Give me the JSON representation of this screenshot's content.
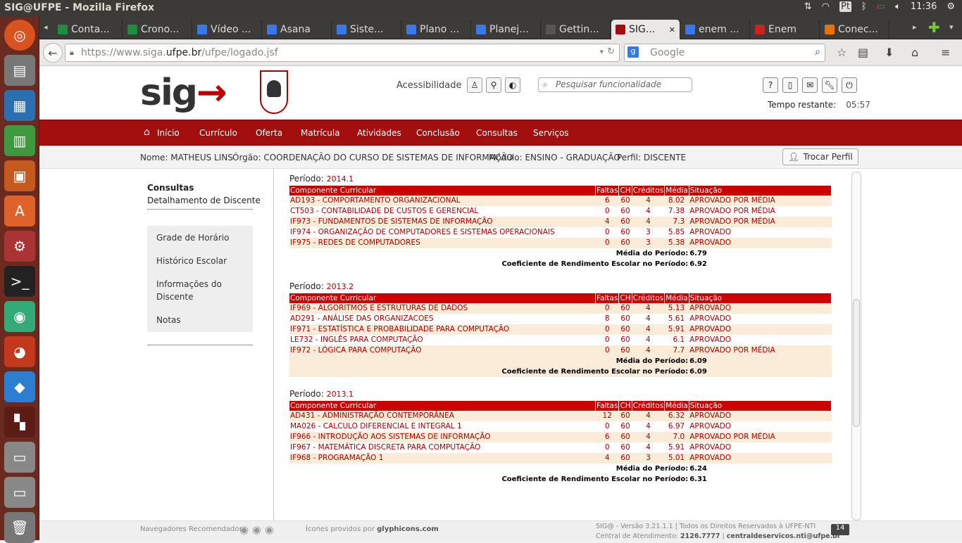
{
  "os": {
    "window_title": "SIG@UFPE - Mozilla Firefox",
    "clock": "11:36"
  },
  "browser": {
    "tabs": [
      {
        "label": "Conta...",
        "color": "#1e8e3e"
      },
      {
        "label": "Crono...",
        "color": "#1e8e3e"
      },
      {
        "label": "Vídeo ...",
        "color": "#3b78e7"
      },
      {
        "label": "Asana",
        "color": "#3b78e7"
      },
      {
        "label": "Siste...",
        "color": "#3b78e7"
      },
      {
        "label": "Plano ...",
        "color": "#3b78e7"
      },
      {
        "label": "Planej...",
        "color": "#3b78e7"
      },
      {
        "label": "Gettin...",
        "color": "#555555"
      },
      {
        "label": "SIG...",
        "color": "#a30e0e"
      },
      {
        "label": "enem ...",
        "color": "#3b78e7"
      },
      {
        "label": "Enem",
        "color": "#cc2222"
      },
      {
        "label": "Conec...",
        "color": "#e8710a"
      }
    ],
    "url_prefix": "https://www.siga.",
    "url_domain": "ufpe.br",
    "url_path": "/ufpe/logado.jsf",
    "search_placeholder": "Google"
  },
  "header": {
    "logo": "sig",
    "accessibility_label": "Acessibilidade",
    "search_placeholder": "Pesquisar funcionalidade",
    "tempo_label": "Tempo restante:",
    "tempo_value": "05:57"
  },
  "menu": [
    "Início",
    "Currículo",
    "Oferta",
    "Matrícula",
    "Atividades",
    "Conclusão",
    "Consultas",
    "Serviços"
  ],
  "user": {
    "nome_label": "Nome:",
    "nome": "MATHEUS LINS",
    "orgao_label": "Órgão:",
    "orgao": "COORDENAÇÃO DO CURSO DE SISTEMAS DE INFORMAÇÃO",
    "modulo_label": "Módulo:",
    "modulo": "ENSINO - GRADUAÇÃO",
    "perfil_label": "Perfil:",
    "perfil": "DISCENTE",
    "trocar": "Trocar Perfil"
  },
  "sidebar": {
    "title": "Consultas",
    "subtitle": "Detalhamento de Discente",
    "items": [
      "Grade de Horário",
      "Histórico Escolar",
      "Informações do Discente",
      "Notas"
    ]
  },
  "columns": [
    "Componente Curricular",
    "Faltas",
    "CH",
    "Créditos",
    "Média",
    "Situação"
  ],
  "periodo_label": "Período:",
  "media_label": "Média do Período:",
  "cre_label": "Coeficiente de Rendimento Escolar no Período:",
  "periods": [
    {
      "periodo": "2014.1",
      "rows": [
        [
          "AD193 - COMPORTAMENTO ORGANIZACIONAL",
          "6",
          "60",
          "4",
          "8.02",
          "APROVADO POR MÉDIA"
        ],
        [
          "CT503 - CONTABILIDADE DE CUSTOS E GERENCIAL",
          "0",
          "60",
          "4",
          "7.38",
          "APROVADO POR MÉDIA"
        ],
        [
          "IF973 - FUNDAMENTOS DE SISTEMAS DE INFORMAÇÃO",
          "4",
          "60",
          "4",
          "7.3",
          "APROVADO POR MÉDIA"
        ],
        [
          "IF974 - ORGANIZAÇÃO DE COMPUTADORES E SISTEMAS OPERACIONAIS",
          "0",
          "60",
          "3",
          "5.85",
          "APROVADO"
        ],
        [
          "IF975 - REDES DE COMPUTADORES",
          "0",
          "60",
          "3",
          "5.38",
          "APROVADO"
        ]
      ],
      "media": "6.79",
      "cre": "6.92"
    },
    {
      "periodo": "2013.2",
      "rows": [
        [
          "IF969 - ALGORITMOS E ESTRUTURAS DE DADOS",
          "0",
          "60",
          "4",
          "5.13",
          "APROVADO"
        ],
        [
          "AD291 - ANÁLISE DAS ORGANIZACOES",
          "8",
          "60",
          "4",
          "5.61",
          "APROVADO"
        ],
        [
          "IF971 - ESTATÍSTICA E PROBABILIDADE PARA COMPUTAÇÃO",
          "0",
          "60",
          "4",
          "5.91",
          "APROVADO"
        ],
        [
          "LE732 - INGLÊS PARA COMPUTAÇÃO",
          "0",
          "60",
          "4",
          "6.1",
          "APROVADO"
        ],
        [
          "IF972 - LÓGICA PARA COMPUTAÇÃO",
          "0",
          "60",
          "4",
          "7.7",
          "APROVADO POR MÉDIA"
        ]
      ],
      "media": "6.09",
      "cre": "6.09"
    },
    {
      "periodo": "2013.1",
      "rows": [
        [
          "AD431 - ADMINISTRAÇÃO CONTEMPORÂNEA",
          "12",
          "60",
          "4",
          "6.32",
          "APROVADO"
        ],
        [
          "MA026 - CALCULO DIFERENCIAL E INTEGRAL 1",
          "0",
          "60",
          "4",
          "6.97",
          "APROVADO"
        ],
        [
          "IF966 - INTRODUÇÃO AOS SISTEMAS DE INFORMAÇÃO",
          "6",
          "60",
          "4",
          "7.0",
          "APROVADO POR MÉDIA"
        ],
        [
          "IF967 - MATEMÁTICA DISCRETA PARA COMPUTAÇÃO",
          "0",
          "60",
          "4",
          "5.91",
          "APROVADO"
        ],
        [
          "IF968 - PROGRAMAÇÃO 1",
          "4",
          "60",
          "3",
          "5.01",
          "APROVADO"
        ]
      ],
      "media": "6.24",
      "cre": "6.31"
    }
  ],
  "footer": {
    "navegadores": "Navegadores Recomendados:",
    "icones_prefix": "Ícones providos por",
    "icones_link": "glyphicons.com",
    "version": "SIG@ - Versão 3.21.1.1 | Todos os Direitos Reservados à UFPE-NTI",
    "central": "Central de Atendimento:",
    "phone": "2126.7777",
    "email": "centraldeservicos.nti@ufpe.br",
    "badge": "14"
  }
}
